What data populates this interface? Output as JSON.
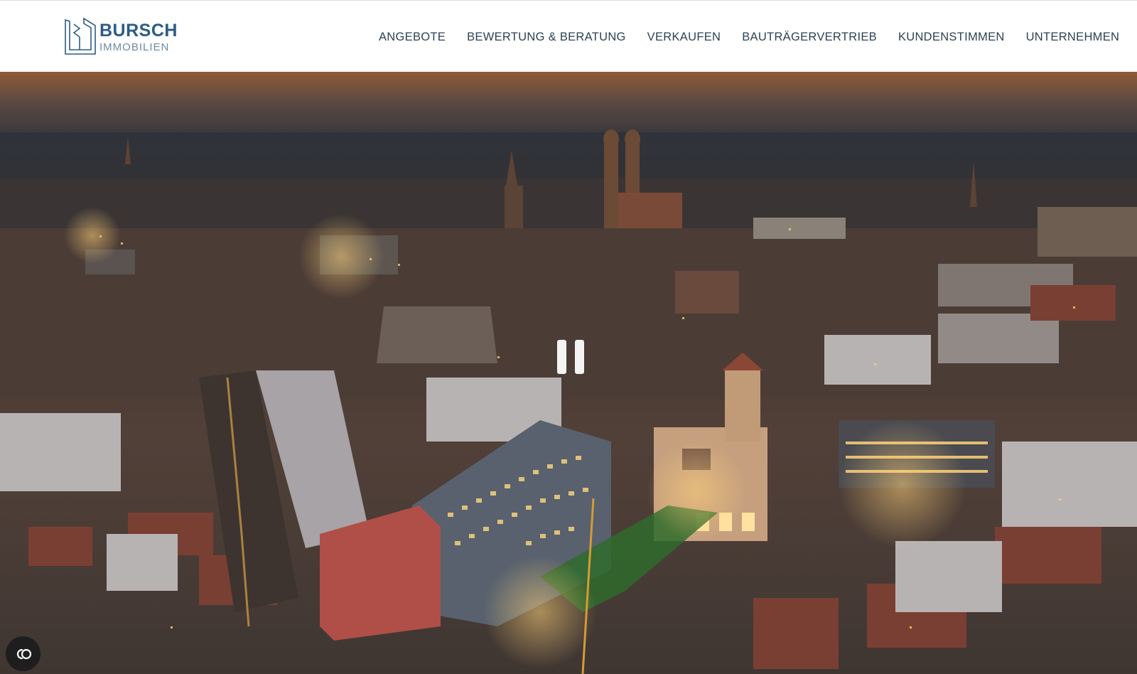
{
  "brand": {
    "name": "BURSCH",
    "subtitle": "IMMOBILIEN",
    "color": "#2c5c86"
  },
  "nav": {
    "items": [
      {
        "label": "ANGEBOTE"
      },
      {
        "label": "BEWERTUNG & BERATUNG"
      },
      {
        "label": "VERKAUFEN"
      },
      {
        "label": "BAUTRÄGERVERTRIEB"
      },
      {
        "label": "KUNDENSTIMMEN"
      },
      {
        "label": "UNTERNEHMEN"
      }
    ]
  },
  "hero": {
    "video_state": "playing",
    "control_icon": "pause-icon"
  },
  "accessibility": {
    "icon": "accessibility-toggle-icon"
  }
}
